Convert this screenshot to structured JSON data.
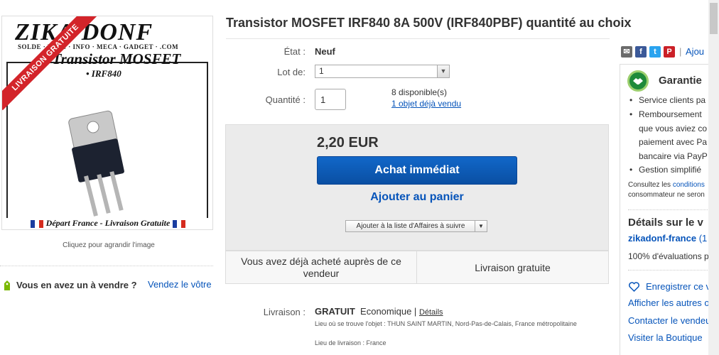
{
  "image": {
    "brand": "ZIKA'DONF",
    "tagline": "SOLDE · ELEC · INFO · MECA · GADGET · .COM",
    "title": "• Transistor MOSFET",
    "part": "• IRF840",
    "footer": "Départ France - Livraison Gratuite",
    "ribbon": "LIVRAISON GRATUITE",
    "caption": "Cliquez pour agrandir l'image"
  },
  "sell": {
    "question": "Vous en avez un à vendre ?",
    "link": "Vendez le vôtre"
  },
  "product": {
    "title": "Transistor MOSFET IRF840 8A 500V (IRF840PBF) quantité au choix",
    "condition_label": "État :",
    "condition_value": "Neuf",
    "lot_label": "Lot de:",
    "lot_value": "1",
    "quantity_label": "Quantité :",
    "quantity_value": "1",
    "available": "8 disponible(s)",
    "sold": "1 objet déjà vendu"
  },
  "buy": {
    "price": "2,20 EUR",
    "buy_now": "Achat immédiat",
    "add_to_cart": "Ajouter au panier",
    "watch": "Ajouter à la liste d'Affaires à suivre"
  },
  "strip": {
    "left": "Vous avez déjà acheté auprès de ce vendeur",
    "right": "Livraison gratuite"
  },
  "shipping": {
    "label": "Livraison :",
    "free": "GRATUIT",
    "method": "Economique |",
    "details": "Détails",
    "item_location": "Lieu où se trouve l'objet : THUN SAINT MARTIN, Nord-Pas-de-Calais, France métropolitaine",
    "delivery_location": "Lieu de livraison : France"
  },
  "share": {
    "separator": "|",
    "add": "Ajou"
  },
  "guarantee": {
    "title": "Garantie",
    "item1": "Service clients pa",
    "item2a": "Remboursement",
    "item2b": "que vous aviez co",
    "item2c": "paiement avec Pa",
    "item2d": "bancaire via PayP",
    "item3": "Gestion simplifié",
    "note_prefix": "Consultez les",
    "note_link": "conditions",
    "note_line2": "consommateur ne seron"
  },
  "seller": {
    "title": "Détails sur le v",
    "name": "zikadonf-france",
    "count": "(1",
    "feedback": "100% d'évaluations p",
    "save": "Enregistrer ce v",
    "other": "Afficher les autres o",
    "contact": "Contacter le vendeu",
    "store": "Visiter la Boutique"
  },
  "colors": {
    "link": "#0654ba",
    "buy_button": "#0a4fa3",
    "ribbon": "#d3242a",
    "guarantee_icon": "#1f8a3a"
  }
}
